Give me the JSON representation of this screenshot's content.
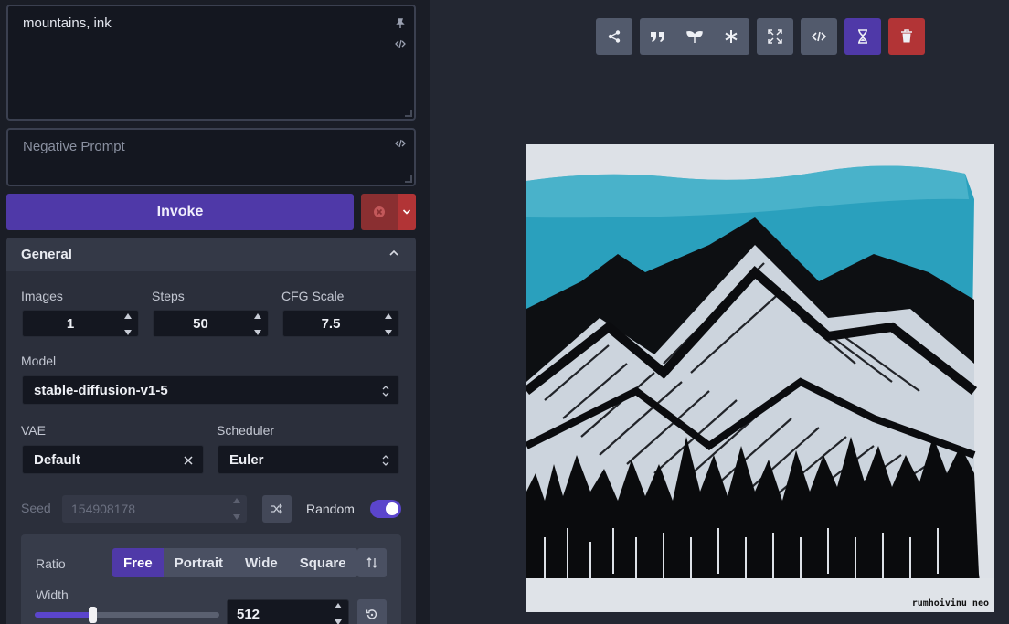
{
  "prompt": {
    "value": "mountains, ink",
    "icons": [
      "pin-icon",
      "code-icon"
    ]
  },
  "negative_prompt": {
    "value": "",
    "placeholder": "Negative Prompt"
  },
  "actions": {
    "invoke_label": "Invoke"
  },
  "general": {
    "title": "General",
    "images": {
      "label": "Images",
      "value": "1"
    },
    "steps": {
      "label": "Steps",
      "value": "50"
    },
    "cfg": {
      "label": "CFG Scale",
      "value": "7.5"
    },
    "model": {
      "label": "Model",
      "value": "stable-diffusion-v1-5"
    },
    "vae": {
      "label": "VAE",
      "value": "Default"
    },
    "scheduler": {
      "label": "Scheduler",
      "value": "Euler"
    },
    "seed": {
      "label": "Seed",
      "value": "154908178",
      "random_label": "Random",
      "random_enabled": true
    },
    "ratio": {
      "label": "Ratio",
      "options": [
        "Free",
        "Portrait",
        "Wide",
        "Square"
      ],
      "selected": "Free"
    },
    "width": {
      "label": "Width",
      "value": "512",
      "slider_fraction": 0.31
    }
  },
  "image_toolbar": {
    "buttons": [
      "share-icon",
      "quote-icon",
      "seedling-icon",
      "asterisk-icon",
      "expand-icon",
      "code-icon",
      "hourglass-icon",
      "trash-icon"
    ]
  },
  "result_image": {
    "signature": "rumhoivinu neo"
  },
  "colors": {
    "accent": "#4f39a8",
    "danger": "#b23436",
    "panel": "#2b2f3b",
    "background": "#1a1d26"
  }
}
